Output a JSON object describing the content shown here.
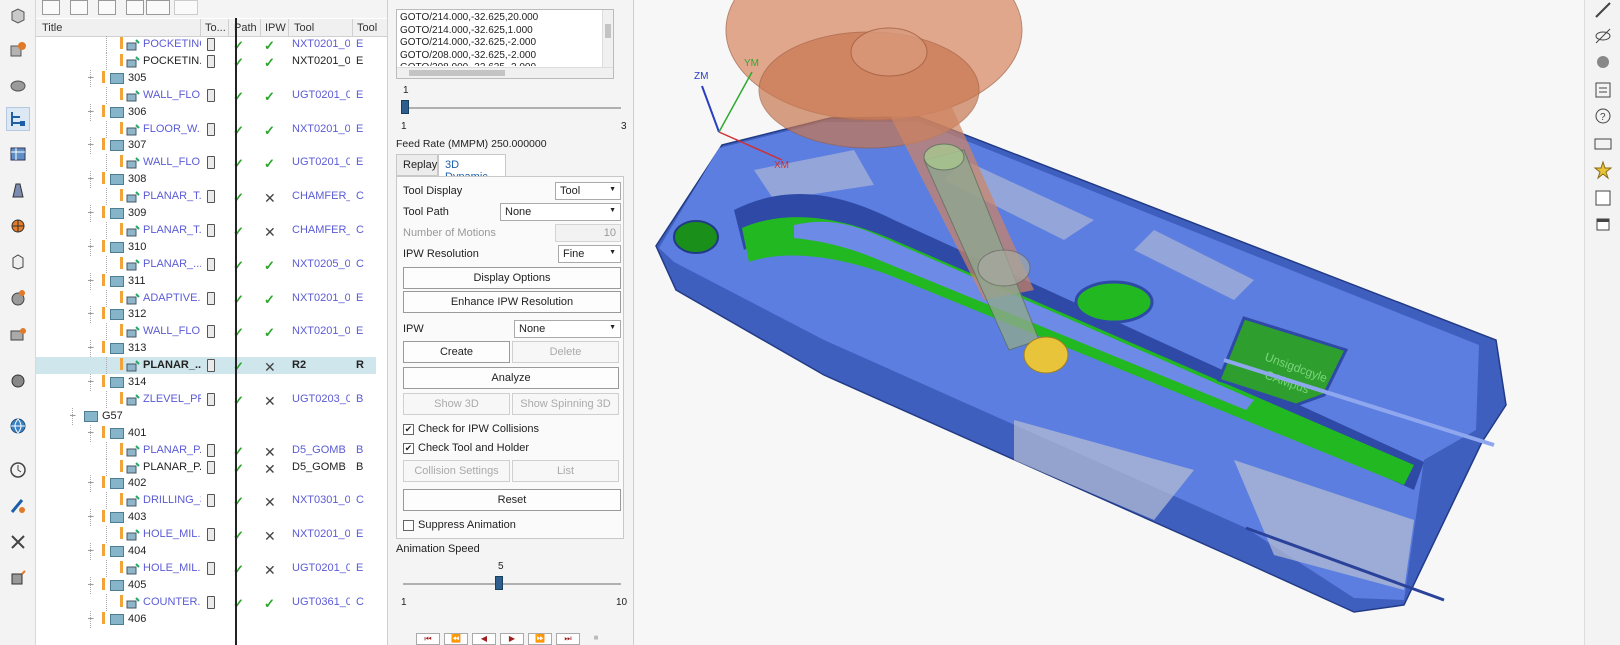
{
  "navigator": {
    "columns": [
      "Title",
      "To...",
      "Path",
      "IPW",
      "Tool",
      "Tool"
    ],
    "rows": [
      {
        "title": "POCKETING",
        "indent": 3,
        "kind": "op",
        "path": "check",
        "ipw": "check",
        "tool": "NXT0201_002",
        "extra": "E",
        "link": true
      },
      {
        "title": "POCKETIN...",
        "indent": 3,
        "kind": "op",
        "path": "check",
        "ipw": "check",
        "tool": "NXT0201_002",
        "extra": "E",
        "link": false
      },
      {
        "title": "305",
        "indent": 2,
        "kind": "group"
      },
      {
        "title": "WALL_FLO...",
        "indent": 3,
        "kind": "op",
        "path": "check",
        "ipw": "check",
        "tool": "UGT0201_098",
        "extra": "E",
        "link": true
      },
      {
        "title": "306",
        "indent": 2,
        "kind": "group"
      },
      {
        "title": "FLOOR_W...",
        "indent": 3,
        "kind": "op",
        "path": "check",
        "ipw": "check",
        "tool": "NXT0201_002",
        "extra": "E",
        "link": true
      },
      {
        "title": "307",
        "indent": 2,
        "kind": "group"
      },
      {
        "title": "WALL_FLO...",
        "indent": 3,
        "kind": "op",
        "path": "check",
        "ipw": "check",
        "tool": "UGT0201_098",
        "extra": "E",
        "link": true
      },
      {
        "title": "308",
        "indent": 2,
        "kind": "group"
      },
      {
        "title": "PLANAR_T...",
        "indent": 3,
        "kind": "op",
        "path": "check",
        "ipw": "x",
        "tool": "CHAMFER_...",
        "extra": "C",
        "link": true
      },
      {
        "title": "309",
        "indent": 2,
        "kind": "group"
      },
      {
        "title": "PLANAR_T...",
        "indent": 3,
        "kind": "op",
        "path": "check",
        "ipw": "x",
        "tool": "CHAMFER_...",
        "extra": "C",
        "link": true
      },
      {
        "title": "310",
        "indent": 2,
        "kind": "group"
      },
      {
        "title": "PLANAR_...",
        "indent": 3,
        "kind": "op",
        "path": "check",
        "ipw": "check",
        "tool": "NXT0205_001",
        "extra": "C",
        "link": true
      },
      {
        "title": "311",
        "indent": 2,
        "kind": "group"
      },
      {
        "title": "ADAPTIVE...",
        "indent": 3,
        "kind": "op",
        "path": "check",
        "ipw": "check",
        "tool": "NXT0201_002",
        "extra": "E",
        "link": true
      },
      {
        "title": "312",
        "indent": 2,
        "kind": "group"
      },
      {
        "title": "WALL_FLO...",
        "indent": 3,
        "kind": "op",
        "path": "check",
        "ipw": "check",
        "tool": "NXT0201_003",
        "extra": "E",
        "link": true
      },
      {
        "title": "313",
        "indent": 2,
        "kind": "group"
      },
      {
        "title": "PLANAR_...",
        "indent": 3,
        "kind": "op",
        "path": "check",
        "ipw": "x",
        "tool": "R2",
        "extra": "R",
        "link": false,
        "selected": true
      },
      {
        "title": "314",
        "indent": 2,
        "kind": "group"
      },
      {
        "title": "ZLEVEL_PR...",
        "indent": 3,
        "kind": "op",
        "path": "check",
        "ipw": "x",
        "tool": "UGT0203_007",
        "extra": "B",
        "link": true
      },
      {
        "title": "G57",
        "indent": 1,
        "kind": "group"
      },
      {
        "title": "401",
        "indent": 2,
        "kind": "group"
      },
      {
        "title": "PLANAR_P...",
        "indent": 3,
        "kind": "op",
        "path": "check",
        "ipw": "x",
        "tool": "D5_GOMB",
        "extra": "B",
        "link": true
      },
      {
        "title": "PLANAR_P...",
        "indent": 3,
        "kind": "op",
        "path": "check",
        "ipw": "x",
        "tool": "D5_GOMB",
        "extra": "B",
        "link": false
      },
      {
        "title": "402",
        "indent": 2,
        "kind": "group"
      },
      {
        "title": "DRILLING_3",
        "indent": 3,
        "kind": "op",
        "path": "check",
        "ipw": "x",
        "tool": "NXT0301_037",
        "extra": "C",
        "link": true
      },
      {
        "title": "403",
        "indent": 2,
        "kind": "group"
      },
      {
        "title": "HOLE_MIL...",
        "indent": 3,
        "kind": "op",
        "path": "check",
        "ipw": "x",
        "tool": "NXT0201_003",
        "extra": "E",
        "link": true
      },
      {
        "title": "404",
        "indent": 2,
        "kind": "group"
      },
      {
        "title": "HOLE_MIL...",
        "indent": 3,
        "kind": "op",
        "path": "check",
        "ipw": "x",
        "tool": "UGT0201_098",
        "extra": "E",
        "link": true
      },
      {
        "title": "405",
        "indent": 2,
        "kind": "group"
      },
      {
        "title": "COUNTER...",
        "indent": 3,
        "kind": "op",
        "path": "check",
        "ipw": "check",
        "tool": "UGT0361_013",
        "extra": "C",
        "link": true
      },
      {
        "title": "406",
        "indent": 2,
        "kind": "group"
      }
    ]
  },
  "panel": {
    "cl_lines": [
      "GOTO/214.000,-32.625,20.000",
      "GOTO/214.000,-32.625,1.000",
      "GOTO/214.000,-32.625,-2.000",
      "GOTO/208.000,-32.625,-2.000",
      "GOTO/208.000,-32.625,-2.000"
    ],
    "step_slider": {
      "value": "1",
      "min": "1",
      "max": "3",
      "fraction": 0.0
    },
    "feed_rate": "Feed Rate (MMPM) 250.000000",
    "tabs": [
      "Replay",
      "3D Dynamic"
    ],
    "active_tab": "3D Dynamic",
    "tool_display_label": "Tool Display",
    "tool_display_value": "Tool",
    "tool_path_label": "Tool Path",
    "tool_path_value": "None",
    "num_motions_label": "Number of Motions",
    "num_motions_value": "10",
    "ipw_res_label": "IPW Resolution",
    "ipw_res_value": "Fine",
    "display_options": "Display Options",
    "enhance_ipw": "Enhance IPW Resolution",
    "ipw_label": "IPW",
    "ipw_value": "None",
    "create": "Create",
    "delete": "Delete",
    "analyze": "Analyze",
    "show3d": "Show 3D",
    "show_spinning": "Show Spinning 3D",
    "check_ipw_collisions": "Check for IPW Collisions",
    "check_tool_holder": "Check Tool and Holder",
    "collision_settings": "Collision Settings",
    "list": "List",
    "reset": "Reset",
    "suppress_animation": "Suppress Animation",
    "anim_speed_label": "Animation Speed",
    "anim_slider": {
      "value": "5",
      "min": "1",
      "max": "10",
      "fraction": 0.44
    }
  },
  "viewport": {
    "axes": {
      "z": "ZM",
      "y": "YM",
      "x": "XM"
    },
    "engraving": [
      "Unsigdcgyle",
      "CAMpus"
    ]
  },
  "colors": {
    "part_blue": "#4b6fd6",
    "cut_green": "#22b822",
    "tool_orange": "#d98d6a",
    "accent_blue": "#1c5ea8"
  }
}
